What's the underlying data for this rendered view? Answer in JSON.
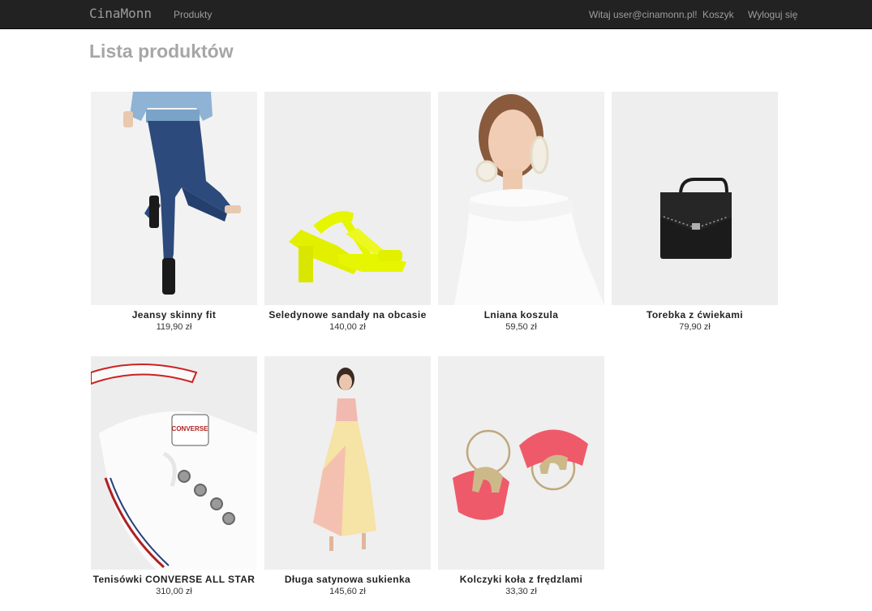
{
  "navbar": {
    "brand": "CinaMonn",
    "products_link": "Produkty",
    "greeting": "Witaj user@cinamonn.pl!",
    "cart_link": "Koszyk",
    "logout_link": "Wyloguj się"
  },
  "page": {
    "title": "Lista produktów"
  },
  "products": [
    {
      "name": "Jeansy skinny fit",
      "price": "119,90 zł"
    },
    {
      "name": "Seledynowe sandały na obcasie",
      "price": "140,00 zł"
    },
    {
      "name": "Lniana koszula",
      "price": "59,50 zł"
    },
    {
      "name": "Torebka z ćwiekami",
      "price": "79,90 zł"
    },
    {
      "name": "Tenisówki CONVERSE ALL STAR",
      "price": "310,00 zł"
    },
    {
      "name": "Długa satynowa sukienka",
      "price": "145,60 zł"
    },
    {
      "name": "Kolczyki koła z frędzlami",
      "price": "33,30 zł"
    }
  ],
  "shoe_brand_text": "CONVERSE"
}
